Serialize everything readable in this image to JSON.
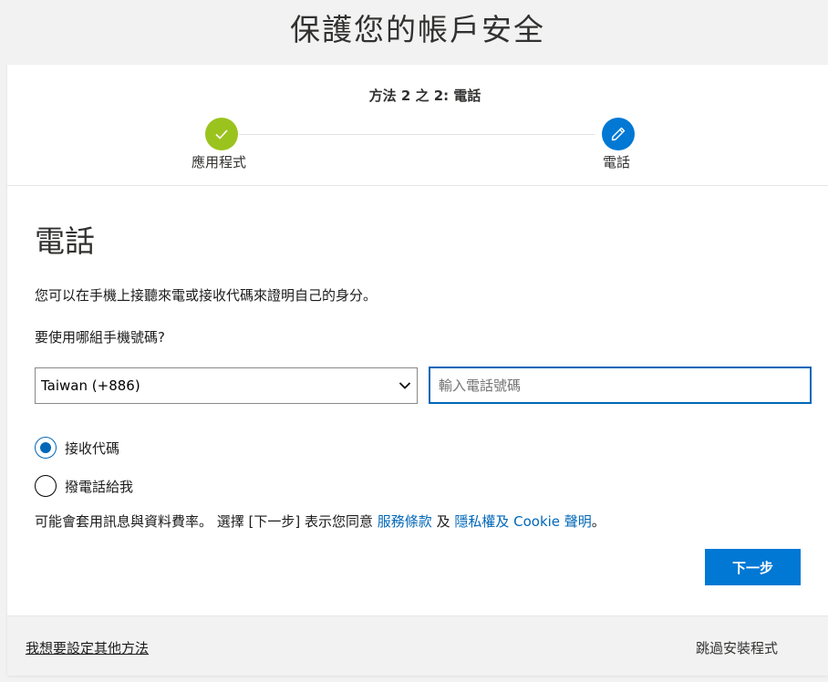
{
  "page": {
    "title": "保護您的帳戶安全"
  },
  "stepper": {
    "heading": "方法 2 之 2: 電話",
    "steps": [
      {
        "label": "應用程式",
        "status": "completed",
        "icon": "check-icon"
      },
      {
        "label": "電話",
        "status": "current",
        "icon": "pencil-icon"
      }
    ]
  },
  "main": {
    "title": "電話",
    "description": "您可以在手機上接聽來電或接收代碼來證明自己的身分。",
    "question": "要使用哪組手機號碼?",
    "country": {
      "selected": "Taiwan (+886)"
    },
    "phone": {
      "value": "",
      "placeholder": "輸入電話號碼"
    },
    "options": [
      {
        "label": "接收代碼",
        "selected": true
      },
      {
        "label": "撥電話給我",
        "selected": false
      }
    ],
    "terms": {
      "prefix": "可能會套用訊息與資料費率。 選擇 [下一步] 表示您同意 ",
      "tos_link": "服務條款",
      "middle": " 及 ",
      "privacy_link": "隱私權及 Cookie 聲明",
      "suffix": "。"
    },
    "next_label": "下一步"
  },
  "footer": {
    "other_method": "我想要設定其他方法",
    "skip": "跳過安裝程式"
  },
  "colors": {
    "accent": "#0078d4",
    "link": "#0067b8",
    "success": "#9bc31e"
  }
}
